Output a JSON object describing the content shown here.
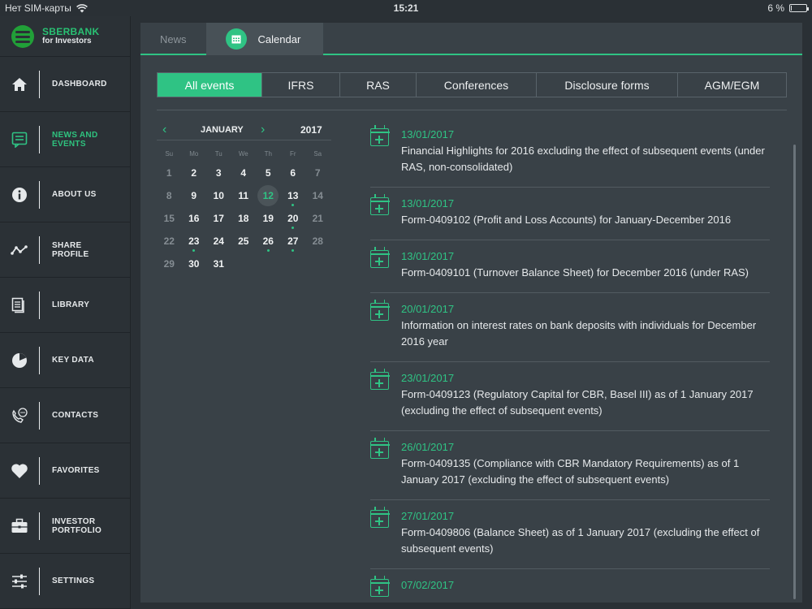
{
  "status_bar": {
    "carrier": "Нет SIM-карты",
    "time": "15:21",
    "battery": "6 %",
    "battery_level": 0.06
  },
  "brand": {
    "title": "SBERBANK",
    "subtitle": "for Investors"
  },
  "sidebar": {
    "items": [
      {
        "label": "DASHBOARD",
        "icon": "home-icon"
      },
      {
        "label": "NEWS AND EVENTS",
        "icon": "news-icon",
        "active": true
      },
      {
        "label": "ABOUT US",
        "icon": "info-icon"
      },
      {
        "label": "SHARE PROFILE",
        "icon": "chart-line-icon"
      },
      {
        "label": "LIBRARY",
        "icon": "library-icon"
      },
      {
        "label": "KEY DATA",
        "icon": "pie-chart-icon"
      },
      {
        "label": "CONTACTS",
        "icon": "phone-icon"
      },
      {
        "label": "FAVORITES",
        "icon": "heart-icon"
      },
      {
        "label": "INVESTOR PORTFOLIO",
        "icon": "briefcase-icon"
      },
      {
        "label": "SETTINGS",
        "icon": "sliders-icon"
      }
    ]
  },
  "top_tabs": {
    "news": "News",
    "calendar": "Calendar"
  },
  "filters": [
    {
      "label": "All events",
      "active": true
    },
    {
      "label": "IFRS"
    },
    {
      "label": "RAS"
    },
    {
      "label": "Conferences"
    },
    {
      "label": "Disclosure forms"
    },
    {
      "label": "AGM/EGM"
    }
  ],
  "calendar": {
    "month": "JANUARY",
    "year": "2017",
    "prev_icon": "chevron-left-icon",
    "next_icon": "chevron-right-icon",
    "weekdays": [
      "Su",
      "Mo",
      "Tu",
      "We",
      "Th",
      "Fr",
      "Sa"
    ],
    "today": 12,
    "event_days": [
      13,
      20,
      23,
      26,
      27
    ],
    "weeks": [
      [
        1,
        2,
        3,
        4,
        5,
        6,
        7
      ],
      [
        8,
        9,
        10,
        11,
        12,
        13,
        14
      ],
      [
        15,
        16,
        17,
        18,
        19,
        20,
        21
      ],
      [
        22,
        23,
        24,
        25,
        26,
        27,
        28
      ],
      [
        29,
        30,
        31
      ]
    ]
  },
  "events": [
    {
      "date": "13/01/2017",
      "title": "Financial Highlights for 2016 excluding the effect of subsequent events (under RAS, non-consolidated)"
    },
    {
      "date": "13/01/2017",
      "title": "Form-0409102 (Profit and Loss Accounts) for January-December 2016"
    },
    {
      "date": "13/01/2017",
      "title": "Form-0409101 (Turnover Balance Sheet) for December 2016 (under RAS)"
    },
    {
      "date": "20/01/2017",
      "title": "Information on interest rates on bank deposits with individuals for December 2016 year"
    },
    {
      "date": "23/01/2017",
      "title": "Form-0409123 (Regulatory Capital for CBR, Basel III) as of 1 January 2017 (excluding the effect of subsequent events)"
    },
    {
      "date": "26/01/2017",
      "title": "Form-0409135 (Compliance with CBR Mandatory Requirements) as of 1 January 2017 (excluding the effect of subsequent events)"
    },
    {
      "date": "27/01/2017",
      "title": "Form-0409806 (Balance Sheet) as of 1 January 2017 (excluding the effect of subsequent events)"
    },
    {
      "date": "07/02/2017",
      "title": ""
    }
  ],
  "colors": {
    "accent": "#2fc384",
    "sidebar_bg": "#2b3136",
    "panel_bg": "#394147"
  }
}
